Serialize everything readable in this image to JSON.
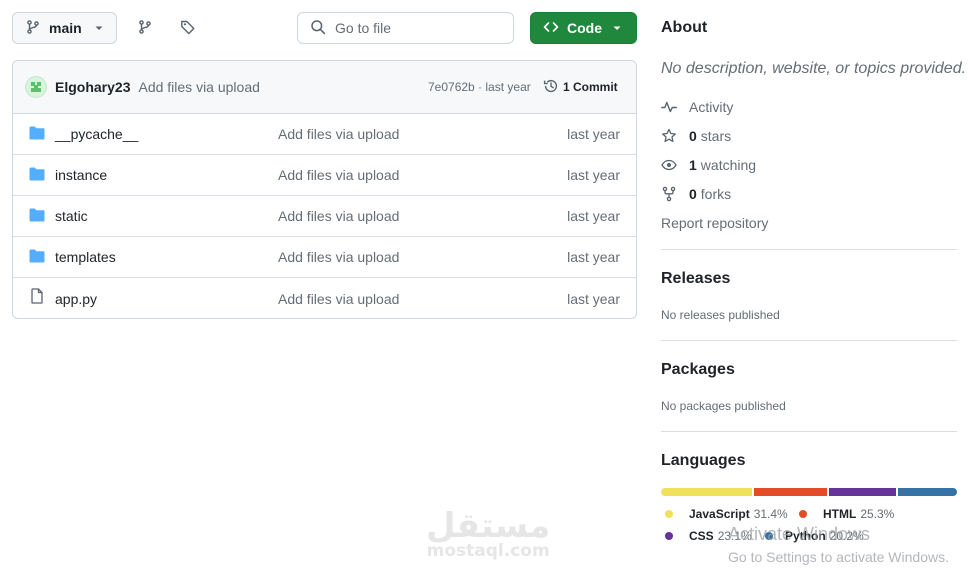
{
  "toolbar": {
    "branch_label": "main",
    "goto_placeholder": "Go to file",
    "code_label": "Code"
  },
  "commit": {
    "author": "Elgohary23",
    "message": "Add files via upload",
    "sha_time": "7e0762b · last year",
    "commits_count": "1 Commit"
  },
  "files": [
    {
      "name": "__pycache__",
      "type": "folder",
      "message": "Add files via upload",
      "date": "last year"
    },
    {
      "name": "instance",
      "type": "folder",
      "message": "Add files via upload",
      "date": "last year"
    },
    {
      "name": "static",
      "type": "folder",
      "message": "Add files via upload",
      "date": "last year"
    },
    {
      "name": "templates",
      "type": "folder",
      "message": "Add files via upload",
      "date": "last year"
    },
    {
      "name": "app.py",
      "type": "file",
      "message": "Add files via upload",
      "date": "last year"
    }
  ],
  "about": {
    "title": "About",
    "description": "No description, website, or topics provided.",
    "activity_label": "Activity",
    "stars_count": "0",
    "stars_label": "stars",
    "watching_count": "1",
    "watching_label": "watching",
    "forks_count": "0",
    "forks_label": "forks",
    "report_label": "Report repository"
  },
  "releases": {
    "title": "Releases",
    "empty": "No releases published"
  },
  "packages": {
    "title": "Packages",
    "empty": "No packages published"
  },
  "languages": {
    "title": "Languages",
    "items": [
      {
        "name": "JavaScript",
        "percent": "31.4%",
        "value": 31.4,
        "color": "#f1e05a"
      },
      {
        "name": "HTML",
        "percent": "25.3%",
        "value": 25.3,
        "color": "#e34c26"
      },
      {
        "name": "CSS",
        "percent": "23.1%",
        "value": 23.1,
        "color": "#663399"
      },
      {
        "name": "Python",
        "percent": "20.2%",
        "value": 20.2,
        "color": "#3572A5"
      }
    ]
  },
  "overlay": {
    "watermark_arabic": "مستقل",
    "watermark_latin": "mostaql.com",
    "activate_title": "Activate Windows",
    "activate_sub": "Go to Settings to activate Windows."
  },
  "colors": {
    "accent_green": "#1f883d",
    "folder_blue": "#54aeff",
    "muted": "#656d76",
    "border": "#d0d7de"
  }
}
